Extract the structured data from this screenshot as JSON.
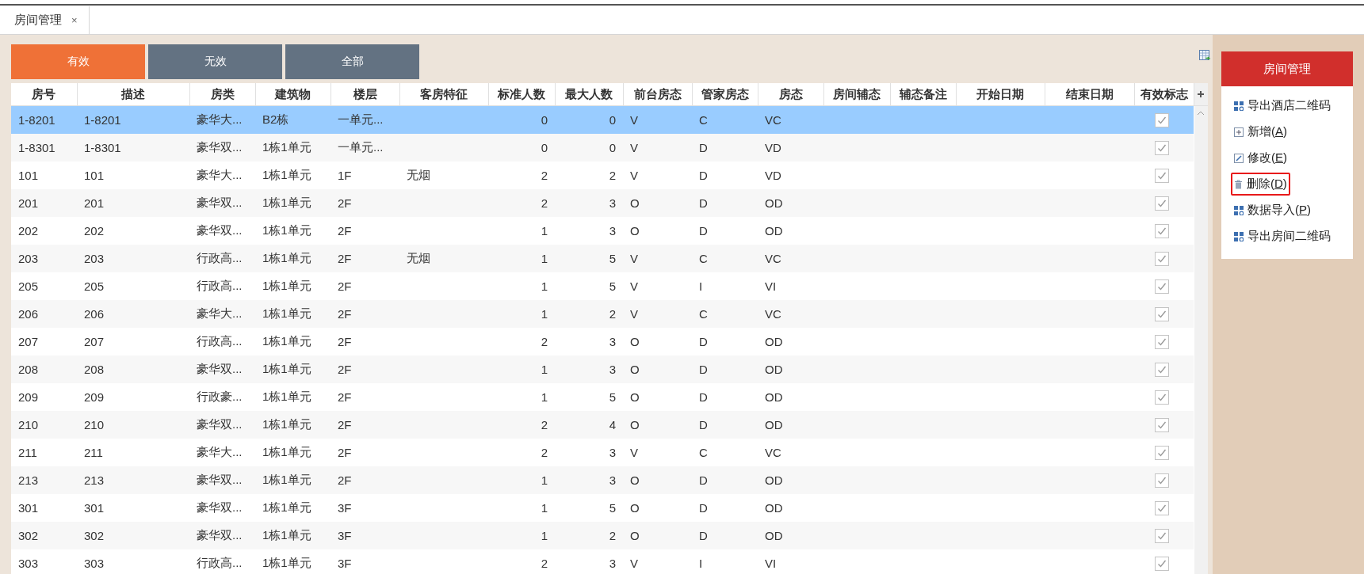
{
  "tab": {
    "label": "房间管理",
    "close": "×"
  },
  "filters": [
    {
      "label": "有效",
      "selected": true
    },
    {
      "label": "无效",
      "selected": false
    },
    {
      "label": "全部",
      "selected": false
    }
  ],
  "table": {
    "columns": [
      "房号",
      "描述",
      "房类",
      "建筑物",
      "楼层",
      "客房特征",
      "标准人数",
      "最大人数",
      "前台房态",
      "管家房态",
      "房态",
      "房间辅态",
      "辅态备注",
      "开始日期",
      "结束日期",
      "有效标志"
    ],
    "rows": [
      {
        "room_no": "1-8201",
        "description": "1-8201",
        "room_type": "豪华大...",
        "building": "B2栋",
        "floor": "一单元...",
        "standard_guests": "0",
        "max_guests": "0",
        "front_desk_status": "V",
        "housekeeping_status": "C",
        "room_status": "VC",
        "valid": true,
        "selected": true
      },
      {
        "room_no": "1-8301",
        "description": "1-8301",
        "room_type": "豪华双...",
        "building": "1栋1单元",
        "floor": "一单元...",
        "standard_guests": "0",
        "max_guests": "0",
        "front_desk_status": "V",
        "housekeeping_status": "D",
        "room_status": "VD",
        "valid": true,
        "selected": false
      },
      {
        "room_no": "101",
        "description": "101",
        "room_type": "豪华大...",
        "building": "1栋1单元",
        "floor": "1F",
        "feature": "无烟",
        "standard_guests": "2",
        "max_guests": "2",
        "front_desk_status": "V",
        "housekeeping_status": "D",
        "room_status": "VD",
        "valid": true,
        "selected": false
      },
      {
        "room_no": "201",
        "description": "201",
        "room_type": "豪华双...",
        "building": "1栋1单元",
        "floor": "2F",
        "standard_guests": "2",
        "max_guests": "3",
        "front_desk_status": "O",
        "housekeeping_status": "D",
        "room_status": "OD",
        "valid": true,
        "selected": false
      },
      {
        "room_no": "202",
        "description": "202",
        "room_type": "豪华双...",
        "building": "1栋1单元",
        "floor": "2F",
        "standard_guests": "1",
        "max_guests": "3",
        "front_desk_status": "O",
        "housekeeping_status": "D",
        "room_status": "OD",
        "valid": true,
        "selected": false
      },
      {
        "room_no": "203",
        "description": "203",
        "room_type": "行政高...",
        "building": "1栋1单元",
        "floor": "2F",
        "feature": "无烟",
        "standard_guests": "1",
        "max_guests": "5",
        "front_desk_status": "V",
        "housekeeping_status": "C",
        "room_status": "VC",
        "valid": true,
        "selected": false
      },
      {
        "room_no": "205",
        "description": "205",
        "room_type": "行政高...",
        "building": "1栋1单元",
        "floor": "2F",
        "standard_guests": "1",
        "max_guests": "5",
        "front_desk_status": "V",
        "housekeeping_status": "I",
        "room_status": "VI",
        "valid": true,
        "selected": false
      },
      {
        "room_no": "206",
        "description": "206",
        "room_type": "豪华大...",
        "building": "1栋1单元",
        "floor": "2F",
        "standard_guests": "1",
        "max_guests": "2",
        "front_desk_status": "V",
        "housekeeping_status": "C",
        "room_status": "VC",
        "valid": true,
        "selected": false
      },
      {
        "room_no": "207",
        "description": "207",
        "room_type": "行政高...",
        "building": "1栋1单元",
        "floor": "2F",
        "standard_guests": "2",
        "max_guests": "3",
        "front_desk_status": "O",
        "housekeeping_status": "D",
        "room_status": "OD",
        "valid": true,
        "selected": false
      },
      {
        "room_no": "208",
        "description": "208",
        "room_type": "豪华双...",
        "building": "1栋1单元",
        "floor": "2F",
        "standard_guests": "1",
        "max_guests": "3",
        "front_desk_status": "O",
        "housekeeping_status": "D",
        "room_status": "OD",
        "valid": true,
        "selected": false
      },
      {
        "room_no": "209",
        "description": "209",
        "room_type": "行政豪...",
        "building": "1栋1单元",
        "floor": "2F",
        "standard_guests": "1",
        "max_guests": "5",
        "front_desk_status": "O",
        "housekeeping_status": "D",
        "room_status": "OD",
        "valid": true,
        "selected": false
      },
      {
        "room_no": "210",
        "description": "210",
        "room_type": "豪华双...",
        "building": "1栋1单元",
        "floor": "2F",
        "standard_guests": "2",
        "max_guests": "4",
        "front_desk_status": "O",
        "housekeeping_status": "D",
        "room_status": "OD",
        "valid": true,
        "selected": false
      },
      {
        "room_no": "211",
        "description": "211",
        "room_type": "豪华大...",
        "building": "1栋1单元",
        "floor": "2F",
        "standard_guests": "2",
        "max_guests": "3",
        "front_desk_status": "V",
        "housekeeping_status": "C",
        "room_status": "VC",
        "valid": true,
        "selected": false
      },
      {
        "room_no": "213",
        "description": "213",
        "room_type": "豪华双...",
        "building": "1栋1单元",
        "floor": "2F",
        "standard_guests": "1",
        "max_guests": "3",
        "front_desk_status": "O",
        "housekeeping_status": "D",
        "room_status": "OD",
        "valid": true,
        "selected": false
      },
      {
        "room_no": "301",
        "description": "301",
        "room_type": "豪华双...",
        "building": "1栋1单元",
        "floor": "3F",
        "standard_guests": "1",
        "max_guests": "5",
        "front_desk_status": "O",
        "housekeeping_status": "D",
        "room_status": "OD",
        "valid": true,
        "selected": false
      },
      {
        "room_no": "302",
        "description": "302",
        "room_type": "豪华双...",
        "building": "1栋1单元",
        "floor": "3F",
        "standard_guests": "1",
        "max_guests": "2",
        "front_desk_status": "O",
        "housekeeping_status": "D",
        "room_status": "OD",
        "valid": true,
        "selected": false
      },
      {
        "room_no": "303",
        "description": "303",
        "room_type": "行政高...",
        "building": "1栋1单元",
        "floor": "3F",
        "standard_guests": "2",
        "max_guests": "3",
        "front_desk_status": "V",
        "housekeeping_status": "I",
        "room_status": "VI",
        "valid": true,
        "selected": false
      }
    ]
  },
  "menu": {
    "title": "房间管理",
    "items": [
      {
        "kind": "export",
        "label": "导出酒店二维码",
        "highlighted": false
      },
      {
        "kind": "add",
        "label_before": "新增(",
        "hotkey": "A",
        "label_after": ")",
        "highlighted": false
      },
      {
        "kind": "edit",
        "label_before": "修改(",
        "hotkey": "E",
        "label_after": ")",
        "highlighted": false
      },
      {
        "kind": "delete",
        "label_before": "删除(",
        "hotkey": "D",
        "label_after": ")",
        "highlighted": true
      },
      {
        "kind": "export",
        "label_before": "数据导入(",
        "hotkey": "P",
        "label_after": ")",
        "highlighted": false
      },
      {
        "kind": "export",
        "label": "导出房间二维码",
        "highlighted": false
      }
    ]
  }
}
